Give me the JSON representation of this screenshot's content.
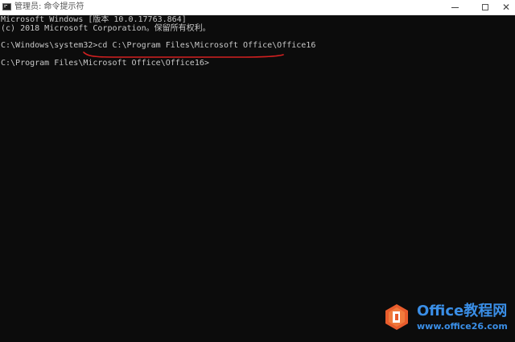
{
  "window": {
    "title": "管理员: 命令提示符",
    "minimize_icon": "minimize-icon",
    "maximize_icon": "maximize-icon",
    "close_icon": "close-icon"
  },
  "console": {
    "lines": [
      "Microsoft Windows [版本 10.0.17763.864]",
      "(c) 2018 Microsoft Corporation。保留所有权利。",
      "C:\\Windows\\system32>cd C:\\Program Files\\Microsoft Office\\Office16",
      "C:\\Program Files\\Microsoft Office\\Office16>"
    ],
    "underline_color": "#d42020",
    "text_color": "#c8c8c8",
    "background_color": "#0c0c0c"
  },
  "watermark": {
    "title": "Office教程网",
    "url": "www.office26.com",
    "logo_color": "#e85c2c",
    "text_color": "#3a8ee6"
  }
}
